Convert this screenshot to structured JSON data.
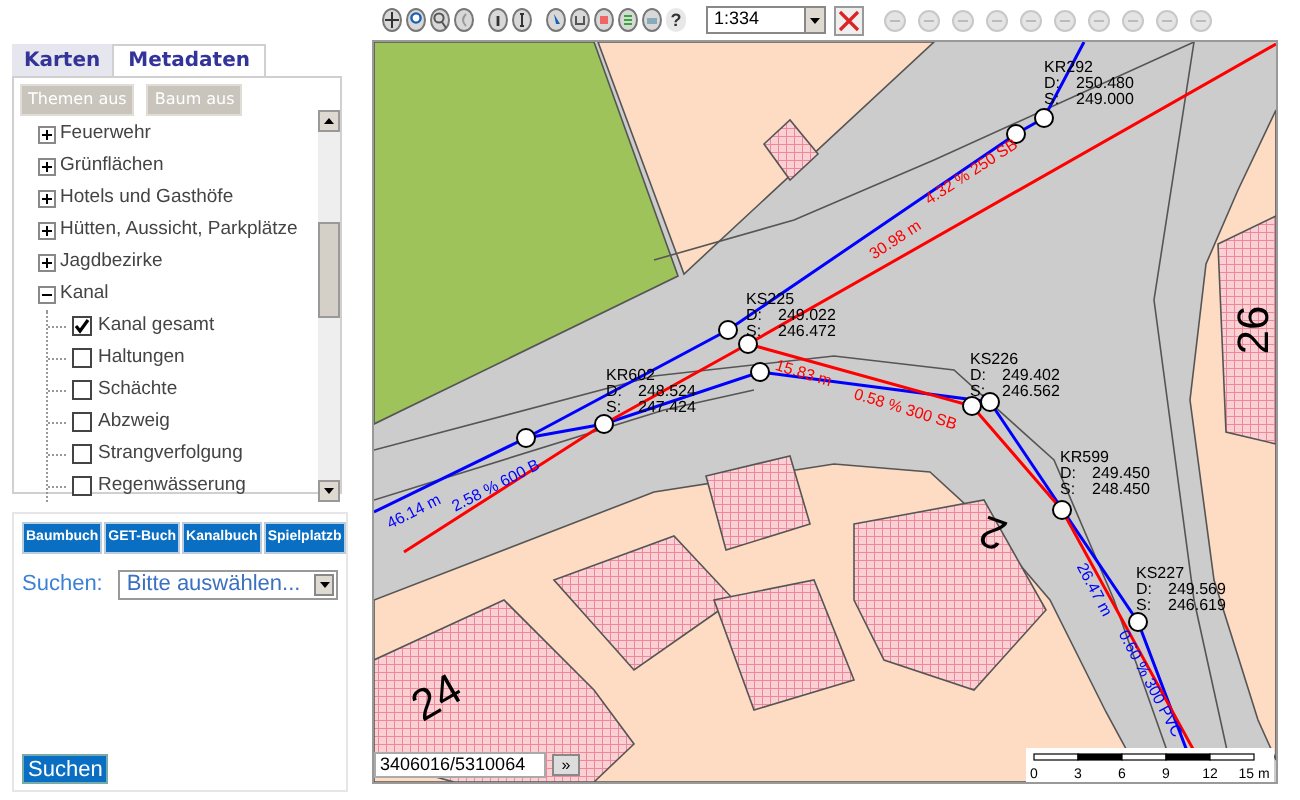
{
  "tabs": [
    {
      "label": "Karten",
      "selected": false
    },
    {
      "label": "Metadaten",
      "selected": true
    }
  ],
  "tree_buttons": [
    "Themen aus",
    "Baum aus"
  ],
  "tree": [
    {
      "label": "Feuerwehr",
      "expanded": false
    },
    {
      "label": "Grünflächen",
      "expanded": false
    },
    {
      "label": "Hotels und Gasthöfe",
      "expanded": false
    },
    {
      "label": "Hütten, Aussicht, Parkplätze",
      "expanded": false
    },
    {
      "label": "Jagdbezirke",
      "expanded": false
    },
    {
      "label": "Kanal",
      "expanded": true,
      "children": [
        {
          "label": "Kanal gesamt",
          "checked": true
        },
        {
          "label": "Haltungen",
          "checked": false
        },
        {
          "label": "Schächte",
          "checked": false
        },
        {
          "label": "Abzweig",
          "checked": false
        },
        {
          "label": "Strangverfolgung",
          "checked": false
        },
        {
          "label": "Regenwässerung",
          "checked": false
        }
      ]
    }
  ],
  "book_buttons": [
    "Baumbuch",
    "GET-Buch",
    "Kanalbuch",
    "Spielplatzb"
  ],
  "search": {
    "label": "Suchen:",
    "value": "Bitte auswählen...",
    "submit": "Suchen"
  },
  "toolbar": {
    "help": "?",
    "scale": "1:334"
  },
  "map": {
    "manholes": [
      {
        "name": "KR292",
        "lines": [
          {
            "key": "D:",
            "value": "250.480"
          },
          {
            "key": "S:",
            "value": "249.000"
          }
        ]
      },
      {
        "name": "KS225",
        "lines": [
          {
            "key": "D:",
            "value": "249.022"
          },
          {
            "key": "S:",
            "value": "246.472"
          }
        ]
      },
      {
        "name": "KR602",
        "lines": [
          {
            "key": "D:",
            "value": "248.524"
          },
          {
            "key": "S:",
            "value": "247.424"
          }
        ]
      },
      {
        "name": "KS226",
        "lines": [
          {
            "key": "D:",
            "value": "249.402"
          },
          {
            "key": "S:",
            "value": "246.562"
          }
        ]
      },
      {
        "name": "KR599",
        "lines": [
          {
            "key": "D:",
            "value": "249.450"
          },
          {
            "key": "S:",
            "value": "248.450"
          }
        ]
      },
      {
        "name": "KS227",
        "lines": [
          {
            "key": "D:",
            "value": "249.569"
          },
          {
            "key": "S:",
            "value": "246.619"
          }
        ]
      }
    ],
    "pipe_labels": [
      {
        "text": "4.32 % 250 SB",
        "color": "#ff0000"
      },
      {
        "text": "30.98 m",
        "color": "#ff0000"
      },
      {
        "text": "46.14 m",
        "color": "#0000ff"
      },
      {
        "text": "2.58 % 600 B",
        "color": "#0000ff"
      },
      {
        "text": "15.83 m",
        "color": "#ff0000"
      },
      {
        "text": "0.58 % 300 SB",
        "color": "#ff0000"
      },
      {
        "text": "26.47 m",
        "color": "#0000ff"
      },
      {
        "text": "0.60 % 300 PVC",
        "color": "#0000ff"
      }
    ],
    "house_numbers": [
      "26",
      "2",
      "24"
    ],
    "coordinates": "3406016/5310064",
    "coordinates_button": "»",
    "scale_bar": [
      "0",
      "3",
      "6",
      "9",
      "12",
      "15 m"
    ]
  }
}
